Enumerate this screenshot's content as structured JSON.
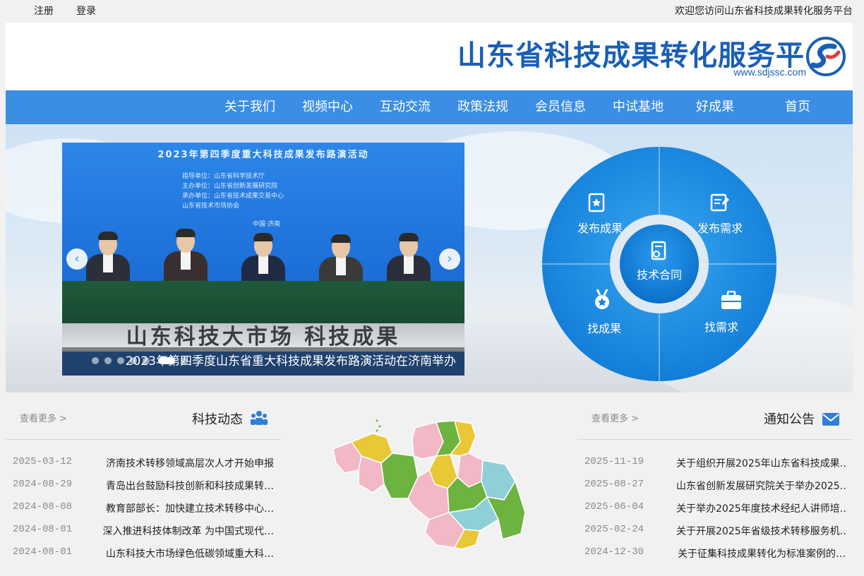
{
  "topbar": {
    "welcome": "欢迎您访问山东省科技成果转化服务平台",
    "login": "登录",
    "register": "注册"
  },
  "header": {
    "title": "山东省科技成果转化服务平台",
    "url": "www.sdjssc.com"
  },
  "nav": {
    "items": [
      "首页",
      "好成果",
      "中试基地",
      "会员信息",
      "政策法规",
      "互动交流",
      "视频中心",
      "关于我们"
    ]
  },
  "slider": {
    "headline": "2023年第四季度重大科技成果发布路演活动",
    "sub_lines": [
      "指导单位：山东省科学技术厅",
      "主办单位：山东省创新发展研究院",
      "承办单位：山东省技术成果交易中心",
      "山东省技术市场协会",
      "中国·济南"
    ],
    "stage_text": "山东科技大市场 科技成果",
    "caption": "2023年第四季度山东省重大科技成果发布路演活动在济南举办",
    "dot_count": 6,
    "active_dot": 5,
    "prev_arrow": "‹",
    "next_arrow": "›"
  },
  "service_wheel": {
    "top_left": "发布成果",
    "top_right": "发布需求",
    "bottom_left": "找成果",
    "bottom_right": "找需求",
    "center": "技术合同",
    "colors": {
      "outer": "#1e8ee6",
      "inner": "#0f7fd9",
      "ring": "#dfeaf4"
    }
  },
  "notices": {
    "title": "通知公告",
    "more": "查看更多 >",
    "items": [
      {
        "title": "关于组织开展2025年山东省科技成果…",
        "date": "2025-11-19"
      },
      {
        "title": "山东省创新发展研究院关于举办2025…",
        "date": "2025-08-27"
      },
      {
        "title": "关于举办2025年度技术经纪人讲师培…",
        "date": "2025-06-04"
      },
      {
        "title": "关于开展2025年省级技术转移服务机…",
        "date": "2025-02-24"
      },
      {
        "title": "关于征集科技成果转化为标准案例的…",
        "date": "2024-12-30"
      }
    ]
  },
  "news": {
    "title": "科技动态",
    "more": "查看更多 >",
    "items": [
      {
        "title": "济南技术转移领域高层次人才开始申报",
        "date": "2025-03-12"
      },
      {
        "title": "青岛出台鼓励科技创新和科技成果转…",
        "date": "2024-08-29"
      },
      {
        "title": "教育部部长：加快建立技术转移中心…",
        "date": "2024-08-08"
      },
      {
        "title": "深入推进科技体制改革 为中国式现代…",
        "date": "2024-08-01"
      },
      {
        "title": "山东科技大市场绿色低碳领域重大科…",
        "date": "2024-08-01"
      }
    ]
  },
  "map": {
    "colors": [
      "#e8c837",
      "#6db33f",
      "#f2b8c6",
      "#8fd0d8"
    ]
  }
}
